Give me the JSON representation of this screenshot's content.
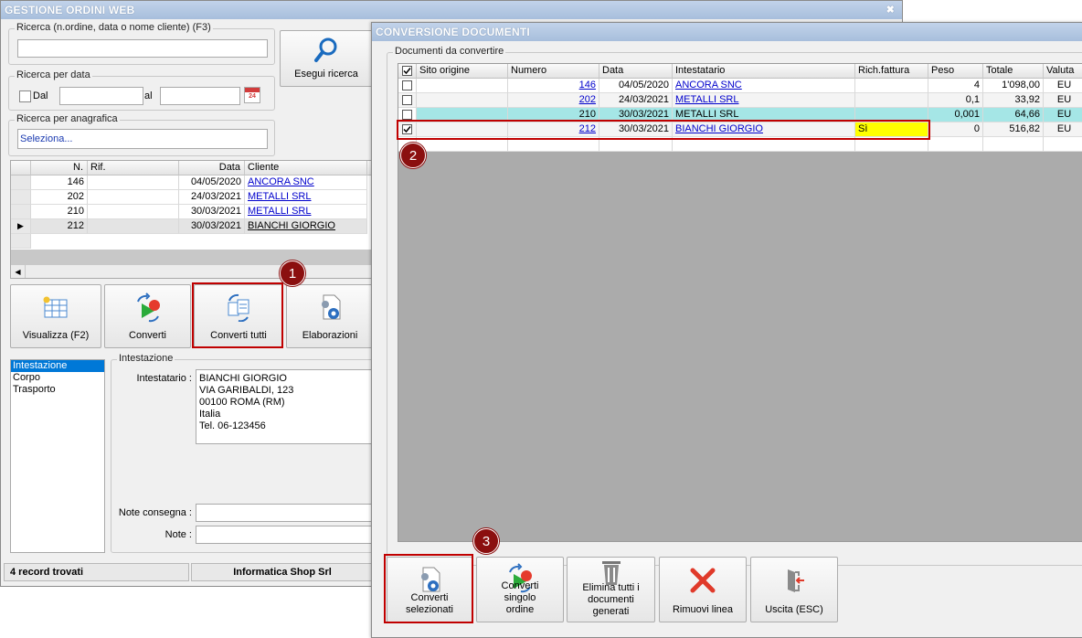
{
  "main_window": {
    "title": "GESTIONE ORDINI WEB",
    "close_glyph": "✖",
    "search": {
      "label": "Ricerca (n.ordine, data o nome cliente) (F3)",
      "value": "",
      "button_label": "Esegui ricerca"
    },
    "date_search": {
      "label": "Ricerca per data",
      "from_label": "Dal",
      "to_label": "al",
      "from_value": "",
      "to_value": "",
      "calendar_day": "24"
    },
    "registry_search": {
      "label": "Ricerca per anagrafica",
      "value": "Seleziona..."
    },
    "orders_grid": {
      "columns": [
        "N.",
        "Rif.",
        "Data",
        "Cliente"
      ],
      "rows": [
        {
          "n": "146",
          "rif": "",
          "data": "04/05/2020",
          "cliente": "ANCORA SNC"
        },
        {
          "n": "202",
          "rif": "",
          "data": "24/03/2021",
          "cliente": "METALLI SRL"
        },
        {
          "n": "210",
          "rif": "",
          "data": "30/03/2021",
          "cliente": "METALLI SRL"
        },
        {
          "n": "212",
          "rif": "",
          "data": "30/03/2021",
          "cliente": "BIANCHI GIORGIO"
        }
      ],
      "current_row_marker": "▶"
    },
    "toolbar": {
      "view_label": "Visualizza (F2)",
      "convert_label": "Converti",
      "convert_all_label": "Converti tutti",
      "processing_label": "Elaborazioni"
    },
    "sections": [
      "Intestazione",
      "Corpo",
      "Trasporto"
    ],
    "header_panel": {
      "group_label": "Intestazione",
      "holder_label": "Intestatario :",
      "holder_lines": [
        "BIANCHI GIORGIO",
        "VIA GARIBALDI, 123",
        "00100 ROMA (RM)",
        "Italia",
        "Tel. 06-123456"
      ],
      "delivery_notes_label": "Note consegna :",
      "notes_label": "Note :"
    },
    "status": {
      "records": "4 record trovati",
      "company": "Informatica Shop Srl"
    }
  },
  "dialog": {
    "title": "CONVERSIONE DOCUMENTI",
    "group_label": "Documenti da convertire",
    "columns": [
      "Sito origine",
      "Numero",
      "Data",
      "Intestatario",
      "Rich.fattura",
      "Peso",
      "Totale",
      "Valuta"
    ],
    "rows": [
      {
        "checked": false,
        "sito": "",
        "numero": "146",
        "data": "04/05/2020",
        "intestatario": "ANCORA SNC",
        "rich": "",
        "peso": "4",
        "totale": "1'098,00",
        "valuta": "EU"
      },
      {
        "checked": false,
        "sito": "",
        "numero": "202",
        "data": "24/03/2021",
        "intestatario": "METALLI SRL",
        "rich": "",
        "peso": "0,1",
        "totale": "33,92",
        "valuta": "EU"
      },
      {
        "checked": false,
        "sito": "",
        "numero": "210",
        "data": "30/03/2021",
        "intestatario": "METALLI SRL",
        "rich": "",
        "peso": "0,001",
        "totale": "64,66",
        "valuta": "EU"
      },
      {
        "checked": true,
        "sito": "",
        "numero": "212",
        "data": "30/03/2021",
        "intestatario": "BIANCHI GIORGIO",
        "rich": "Sì",
        "peso": "0",
        "totale": "516,82",
        "valuta": "EU"
      }
    ],
    "buttons": {
      "convert_selected": "Converti selezionati",
      "convert_single": "Converti singolo ordine",
      "delete_all": "Elimina tutti i documenti generati",
      "remove_line": "Rimuovi linea",
      "exit": "Uscita (ESC)"
    }
  },
  "callouts": [
    "1",
    "2",
    "3"
  ],
  "colors": {
    "callout": "#8b0f0f",
    "highlight_box": "#c00000",
    "row_selected": "#a5e6e6",
    "yes_cell": "#ffff00",
    "title_bar": "#a7bedc"
  }
}
